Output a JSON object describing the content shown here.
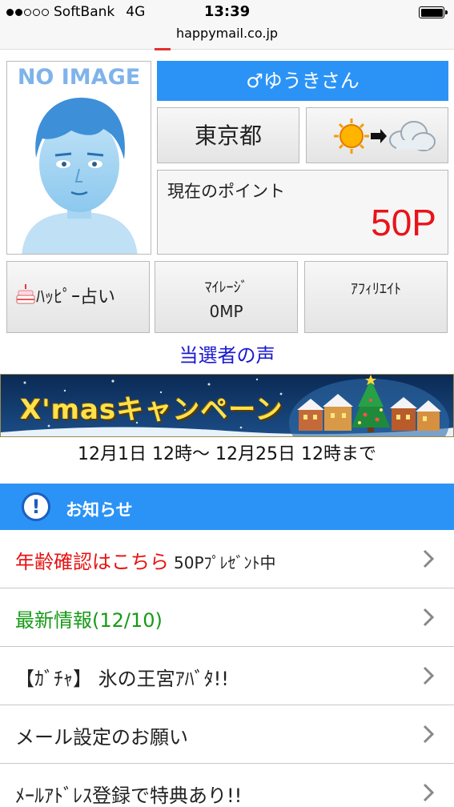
{
  "status_bar": {
    "carrier": "SoftBank",
    "network": "4G",
    "time": "13:39",
    "signal_filled": 2,
    "signal_total": 5
  },
  "browser": {
    "url": "happymail.co.jp"
  },
  "profile": {
    "avatar_placeholder": "NO IMAGE",
    "username": "♂ゆうきさん",
    "prefecture": "東京都",
    "weather_icon": "sun-to-cloud-icon",
    "points_label": "現在のポイント",
    "points_value": "50P"
  },
  "menu_buttons": {
    "happy_fortune": "ﾊｯﾋﾟｰ占い",
    "mileage_label": "ﾏｲﾚｰｼﾞ",
    "mileage_value": "0MP",
    "affiliate": "ｱﾌｨﾘｴｲﾄ"
  },
  "winners_link": "当選者の声",
  "campaign": {
    "banner_text": "X'masキャンペーン",
    "dates": "12月1日 12時〜 12月25日 12時まで"
  },
  "notices": {
    "header_title": "お知らせ",
    "header_icon": "exclamation-circle-icon",
    "items": [
      {
        "text": "年齢確認はこちら",
        "suffix": "50Pﾌﾟﾚｾﾞﾝﾄ中",
        "color": "#e81212"
      },
      {
        "text": "最新情報(12/10)",
        "color": "#179a17"
      },
      {
        "text": "【ｶﾞﾁｬ】 氷の王宮ｱﾊﾞﾀ!!",
        "color": "#222222"
      },
      {
        "text": "メール設定のお願い",
        "color": "#222222"
      },
      {
        "text": "ﾒｰﾙｱﾄﾞﾚｽ登録で特典あり!!",
        "color": "#222222"
      }
    ]
  },
  "colors": {
    "accent_blue": "#2b93f6",
    "points_red": "#e8141a",
    "link_blue": "#1a1ad0"
  }
}
